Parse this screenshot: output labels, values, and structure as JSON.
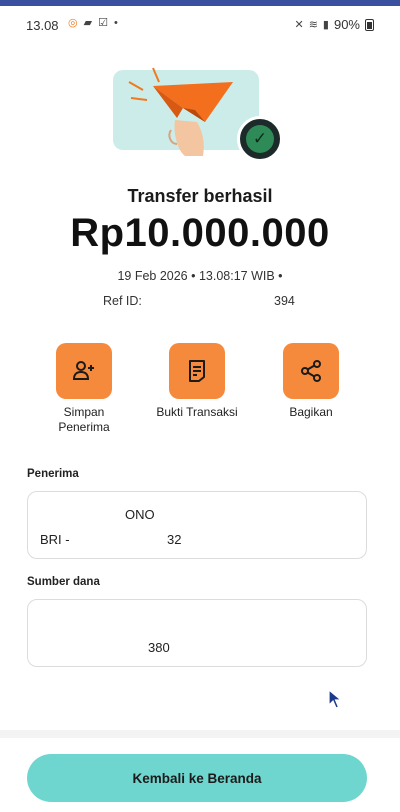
{
  "status_bar": {
    "time": "13.08",
    "battery": "90%"
  },
  "result": {
    "title": "Transfer berhasil",
    "amount": "Rp10.000.000",
    "datetime": "19 Feb 2026 • 13.08:17 WIB •",
    "ref_label": "Ref ID:",
    "ref_value": "394"
  },
  "actions": [
    {
      "label": "Simpan Penerima",
      "icon": "add-person-icon"
    },
    {
      "label": "Bukti Transaksi",
      "icon": "receipt-icon"
    },
    {
      "label": "Bagikan",
      "icon": "share-icon"
    }
  ],
  "recipient": {
    "label": "Penerima",
    "name": "ONO",
    "bank_prefix": "BRI -",
    "account_suffix": "32"
  },
  "source": {
    "label": "Sumber dana",
    "account_suffix": "380"
  },
  "cta": {
    "label": "Kembali ke Beranda"
  },
  "colors": {
    "accent_orange": "#f58a3c",
    "cta_teal": "#6fd6cf",
    "success_green": "#2e8b57"
  }
}
